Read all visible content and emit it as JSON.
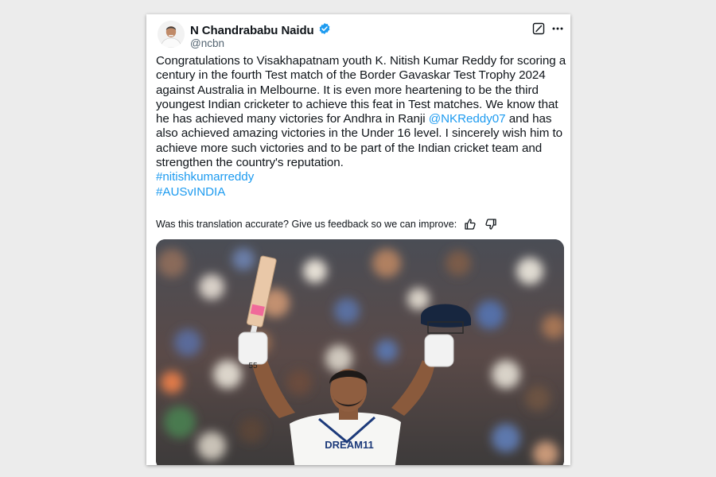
{
  "author": {
    "name": "N Chandrababu Naidu",
    "handle": "@ncbn",
    "verified": true
  },
  "post": {
    "text_1": "Congratulations to Visakhapatnam youth K. Nitish Kumar Reddy for scoring a century in the fourth Test match of the Border Gavaskar Test Trophy 2024 against Australia in Melbourne. It is even more heartening to be the third youngest Indian cricketer to achieve this feat in Test matches. We know that he has achieved many victories for Andhra in Ranji ",
    "mention": "@NKReddy07",
    "text_2": " and has also achieved amazing victories in the Under 16 level. I sincerely wish him to achieve more such victories and to be part of the Indian cricket team and strengthen the country's reputation.",
    "hashtags": [
      "#nitishkumarreddy",
      "#AUSvINDIA"
    ]
  },
  "translation_feedback": {
    "prompt": "Was this translation accurate? Give us feedback so we can improve:"
  },
  "media": {
    "jersey_text": "DREAM11",
    "jersey_number": "55"
  },
  "colors": {
    "link": "#1d9bf0",
    "verified": "#1d9bf0",
    "secondary_text": "#536471"
  },
  "icons": {
    "verified": "verified-badge-icon",
    "grok": "grok-icon",
    "more": "more-options-icon",
    "thumbs_up": "thumbs-up-icon",
    "thumbs_down": "thumbs-down-icon"
  }
}
